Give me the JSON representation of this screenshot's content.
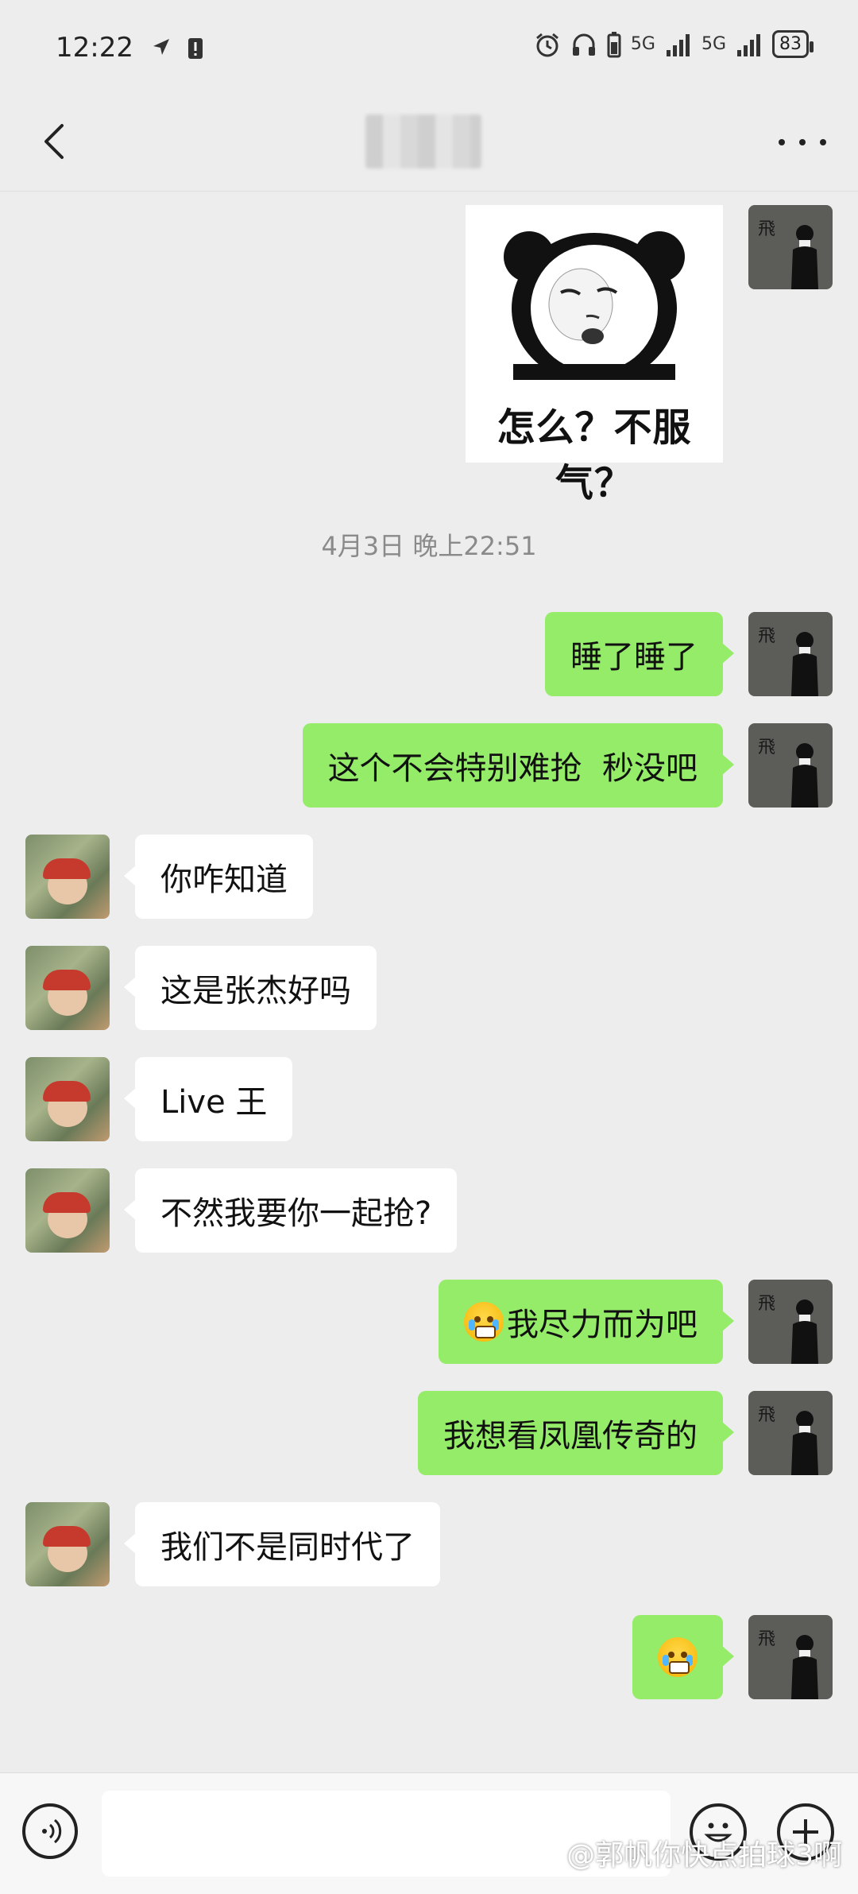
{
  "status_bar": {
    "time": "12:22",
    "signal1": "5G",
    "signal2": "5G",
    "battery": "83"
  },
  "nav": {
    "title": "",
    "back_icon": "chevron-left-icon",
    "more_icon": "more-horizontal-icon"
  },
  "sticker": {
    "caption": "怎么？不服气？"
  },
  "timestamp": "4月3日 晚上22:51",
  "messages": [
    {
      "sender": "self",
      "text": "睡了睡了"
    },
    {
      "sender": "self",
      "text": "这个不会特别难抢  秒没吧"
    },
    {
      "sender": "other",
      "text": "你咋知道"
    },
    {
      "sender": "other",
      "text": "这是张杰好吗"
    },
    {
      "sender": "other",
      "text": "Live 王"
    },
    {
      "sender": "other",
      "text": "不然我要你一起抢?"
    },
    {
      "sender": "self",
      "text": "我尽力而为吧",
      "emoji": "crying-face"
    },
    {
      "sender": "self",
      "text": "我想看凤凰传奇的"
    },
    {
      "sender": "other",
      "text": "我们不是同时代了"
    },
    {
      "sender": "self",
      "text": "",
      "emoji": "crying-face"
    }
  ],
  "self_avatar_char": "飛",
  "input": {
    "value": "",
    "placeholder": ""
  },
  "watermark": "@郭帆你快点拍球3啊",
  "colors": {
    "self_bubble": "#95ec69",
    "other_bubble": "#ffffff",
    "background": "#ededed"
  }
}
